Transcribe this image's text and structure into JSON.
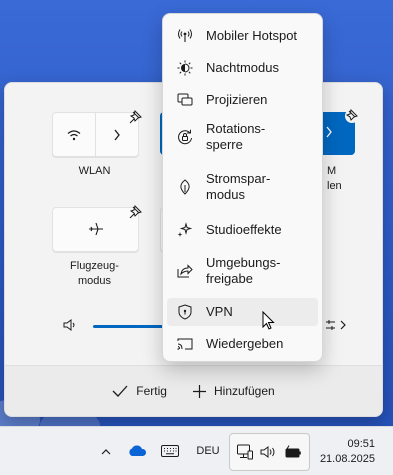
{
  "quick_settings": {
    "wlan_label": "WLAN",
    "airplane_label_line1": "Flugzeug-",
    "airplane_label_line2": "modus",
    "hidden_tile_label_line1": "M",
    "hidden_tile_label_line2": "len",
    "footer": {
      "done_label": "Fertig",
      "add_label": "Hinzufügen"
    }
  },
  "menu": {
    "items": [
      {
        "label": "Mobiler Hotspot",
        "icon": "hotspot-icon"
      },
      {
        "label": "Nachtmodus",
        "icon": "night-light-icon"
      },
      {
        "label": "Projizieren",
        "icon": "project-icon"
      },
      {
        "label": "Rotations-\nsperre",
        "icon": "rotation-lock-icon"
      },
      {
        "label": "Stromspar-\nmodus",
        "icon": "battery-saver-icon"
      },
      {
        "label": "Studioeffekte",
        "icon": "studio-effects-icon"
      },
      {
        "label": "Umgebungs-\nfreigabe",
        "icon": "nearby-share-icon"
      },
      {
        "label": "VPN",
        "icon": "vpn-icon",
        "hovered": true
      },
      {
        "label": "Wiedergeben",
        "icon": "cast-icon"
      }
    ]
  },
  "taskbar": {
    "language": "DEU",
    "time": "09:51",
    "date": "21.08.2025"
  },
  "colors": {
    "accent": "#0067c0",
    "panel": "#f3f3f3"
  }
}
